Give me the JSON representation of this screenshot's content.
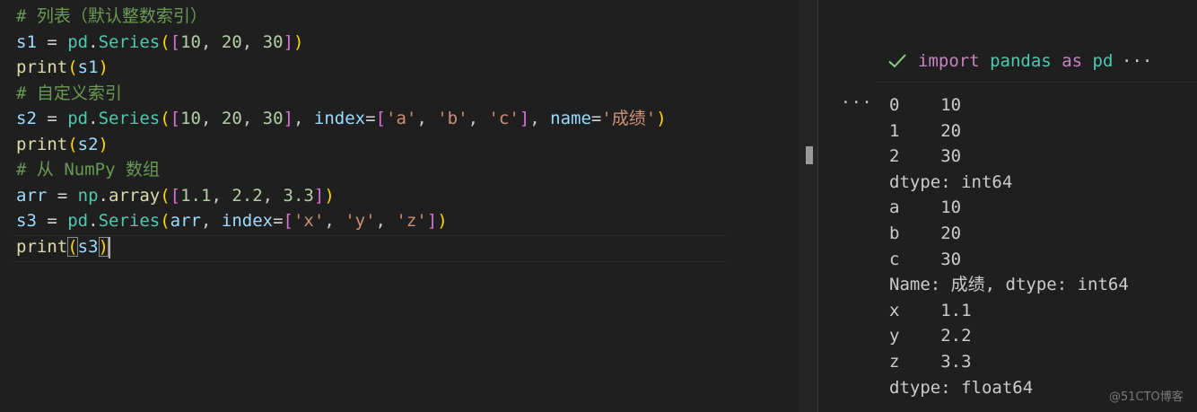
{
  "editor": {
    "lines": [
      {
        "tokens": [
          {
            "t": "# 列表（默认整数索引）",
            "c": "comment"
          }
        ]
      },
      {
        "tokens": [
          {
            "t": "s1",
            "c": "var"
          },
          {
            "t": " = ",
            "c": "op"
          },
          {
            "t": "pd",
            "c": "mod"
          },
          {
            "t": ".",
            "c": "op"
          },
          {
            "t": "Series",
            "c": "mod"
          },
          {
            "t": "(",
            "c": "b1"
          },
          {
            "t": "[",
            "c": "b2"
          },
          {
            "t": "10",
            "c": "num"
          },
          {
            "t": ", ",
            "c": "p"
          },
          {
            "t": "20",
            "c": "num"
          },
          {
            "t": ", ",
            "c": "p"
          },
          {
            "t": "30",
            "c": "num"
          },
          {
            "t": "]",
            "c": "b2"
          },
          {
            "t": ")",
            "c": "b1"
          }
        ]
      },
      {
        "tokens": [
          {
            "t": "print",
            "c": "fn"
          },
          {
            "t": "(",
            "c": "b1"
          },
          {
            "t": "s1",
            "c": "var"
          },
          {
            "t": ")",
            "c": "b1"
          }
        ]
      },
      {
        "tokens": [
          {
            "t": "# 自定义索引",
            "c": "comment"
          }
        ]
      },
      {
        "tokens": [
          {
            "t": "s2",
            "c": "var"
          },
          {
            "t": " = ",
            "c": "op"
          },
          {
            "t": "pd",
            "c": "mod"
          },
          {
            "t": ".",
            "c": "op"
          },
          {
            "t": "Series",
            "c": "mod"
          },
          {
            "t": "(",
            "c": "b1"
          },
          {
            "t": "[",
            "c": "b2"
          },
          {
            "t": "10",
            "c": "num"
          },
          {
            "t": ", ",
            "c": "p"
          },
          {
            "t": "20",
            "c": "num"
          },
          {
            "t": ", ",
            "c": "p"
          },
          {
            "t": "30",
            "c": "num"
          },
          {
            "t": "]",
            "c": "b2"
          },
          {
            "t": ", ",
            "c": "p"
          },
          {
            "t": "index",
            "c": "var"
          },
          {
            "t": "=",
            "c": "op"
          },
          {
            "t": "[",
            "c": "b2"
          },
          {
            "t": "'a'",
            "c": "str"
          },
          {
            "t": ", ",
            "c": "p"
          },
          {
            "t": "'b'",
            "c": "str"
          },
          {
            "t": ", ",
            "c": "p"
          },
          {
            "t": "'c'",
            "c": "str"
          },
          {
            "t": "]",
            "c": "b2"
          },
          {
            "t": ", ",
            "c": "p"
          },
          {
            "t": "name",
            "c": "var"
          },
          {
            "t": "=",
            "c": "op"
          },
          {
            "t": "'成绩'",
            "c": "str"
          },
          {
            "t": ")",
            "c": "b1"
          }
        ]
      },
      {
        "tokens": [
          {
            "t": "print",
            "c": "fn"
          },
          {
            "t": "(",
            "c": "b1"
          },
          {
            "t": "s2",
            "c": "var"
          },
          {
            "t": ")",
            "c": "b1"
          }
        ]
      },
      {
        "tokens": [
          {
            "t": "# 从 NumPy 数组",
            "c": "comment"
          }
        ]
      },
      {
        "tokens": [
          {
            "t": "arr",
            "c": "var"
          },
          {
            "t": " = ",
            "c": "op"
          },
          {
            "t": "np",
            "c": "mod"
          },
          {
            "t": ".",
            "c": "op"
          },
          {
            "t": "array",
            "c": "fn"
          },
          {
            "t": "(",
            "c": "b1"
          },
          {
            "t": "[",
            "c": "b2"
          },
          {
            "t": "1.1",
            "c": "num"
          },
          {
            "t": ", ",
            "c": "p"
          },
          {
            "t": "2.2",
            "c": "num"
          },
          {
            "t": ", ",
            "c": "p"
          },
          {
            "t": "3.3",
            "c": "num"
          },
          {
            "t": "]",
            "c": "b2"
          },
          {
            "t": ")",
            "c": "b1"
          }
        ]
      },
      {
        "tokens": [
          {
            "t": "s3",
            "c": "var"
          },
          {
            "t": " = ",
            "c": "op"
          },
          {
            "t": "pd",
            "c": "mod"
          },
          {
            "t": ".",
            "c": "op"
          },
          {
            "t": "Series",
            "c": "mod"
          },
          {
            "t": "(",
            "c": "b1"
          },
          {
            "t": "arr",
            "c": "var"
          },
          {
            "t": ", ",
            "c": "p"
          },
          {
            "t": "index",
            "c": "var"
          },
          {
            "t": "=",
            "c": "op"
          },
          {
            "t": "[",
            "c": "b2"
          },
          {
            "t": "'x'",
            "c": "str"
          },
          {
            "t": ", ",
            "c": "p"
          },
          {
            "t": "'y'",
            "c": "str"
          },
          {
            "t": ", ",
            "c": "p"
          },
          {
            "t": "'z'",
            "c": "str"
          },
          {
            "t": "]",
            "c": "b2"
          },
          {
            "t": ")",
            "c": "b1"
          }
        ]
      },
      {
        "tokens": [
          {
            "t": "print",
            "c": "fn"
          },
          {
            "t": "(",
            "c": "b1",
            "bm": true
          },
          {
            "t": "s3",
            "c": "var"
          },
          {
            "t": ")",
            "c": "b1",
            "bm": true
          }
        ]
      }
    ]
  },
  "cell": {
    "status_icon": "check-icon",
    "status_color": "#89d185",
    "code_kw": "import",
    "code_mod": "pandas",
    "code_as": "as",
    "code_alias": "pd",
    "more": "···"
  },
  "output": {
    "more": "···",
    "lines": [
      "0    10",
      "1    20",
      "2    30",
      "dtype: int64",
      "a    10",
      "b    20",
      "c    30",
      "Name: 成绩, dtype: int64",
      "x    1.1",
      "y    2.2",
      "z    3.3",
      "dtype: float64"
    ]
  },
  "watermark": "@51CTO博客"
}
